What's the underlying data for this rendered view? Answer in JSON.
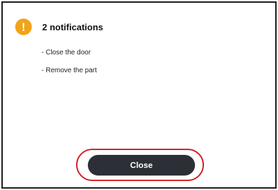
{
  "dialog": {
    "icon": "exclamation-warning-icon",
    "icon_glyph": "!",
    "accent_color": "#f0a419",
    "title": "2 notifications",
    "items": [
      "- Close the door",
      "- Remove the part"
    ],
    "close_label": "Close",
    "highlight_color": "#d3212a"
  }
}
